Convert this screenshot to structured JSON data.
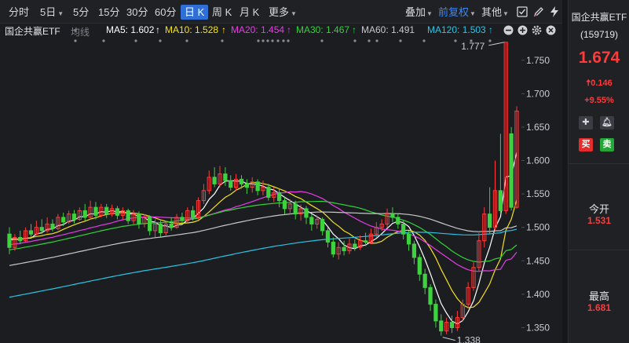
{
  "toolbar": {
    "periods": [
      {
        "label": "分时",
        "active": false
      },
      {
        "label": "5日",
        "active": false,
        "dropdown": true
      },
      {
        "label": "5分",
        "active": false
      },
      {
        "label": "15分",
        "active": false
      },
      {
        "label": "30分",
        "active": false
      },
      {
        "label": "60分",
        "active": false
      },
      {
        "label": "日 K",
        "active": true
      },
      {
        "label": "周 K",
        "active": false
      },
      {
        "label": "月 K",
        "active": false
      },
      {
        "label": "更多",
        "active": false,
        "dropdown": true
      }
    ],
    "overlay_label": "叠加",
    "adjust_label": "前复权",
    "other_label": "其他",
    "icons": [
      "checkbox-icon",
      "pencil-icon",
      "lightning-icon"
    ]
  },
  "ma_bar": {
    "indicator_label": "均线",
    "items": [
      {
        "label": "MA5: 1.602",
        "color": "#ffffff"
      },
      {
        "label": "MA10: 1.528",
        "color": "#f5e11d"
      },
      {
        "label": "MA20: 1.454",
        "color": "#e83be8"
      },
      {
        "label": "MA30: 1.467",
        "color": "#32d23a"
      },
      {
        "label": "MA60: 1.491",
        "color": "#c8c8c8"
      },
      {
        "label": "MA120: 1.503",
        "color": "#29c5e6"
      }
    ]
  },
  "chart_data": {
    "type": "candlestick",
    "y_ticks": [
      "1.750",
      "1.700",
      "1.650",
      "1.600",
      "1.550",
      "1.500",
      "1.450",
      "1.400",
      "1.350"
    ],
    "ylim": [
      1.327,
      1.785
    ],
    "high_label": "1.777",
    "low_label": "1.338",
    "up_color": "#ff3b3b",
    "down_color": "#3ed23e",
    "candles": [
      [
        1.49,
        1.47,
        1.5,
        1.46
      ],
      [
        1.47,
        1.485,
        1.49,
        1.465
      ],
      [
        1.485,
        1.48,
        1.495,
        1.475
      ],
      [
        1.48,
        1.495,
        1.5,
        1.478
      ],
      [
        1.495,
        1.49,
        1.505,
        1.485
      ],
      [
        1.49,
        1.5,
        1.51,
        1.488
      ],
      [
        1.5,
        1.495,
        1.512,
        1.49
      ],
      [
        1.495,
        1.505,
        1.515,
        1.492
      ],
      [
        1.505,
        1.498,
        1.512,
        1.494
      ],
      [
        1.498,
        1.515,
        1.52,
        1.496
      ],
      [
        1.515,
        1.508,
        1.522,
        1.502
      ],
      [
        1.508,
        1.52,
        1.525,
        1.505
      ],
      [
        1.52,
        1.512,
        1.526,
        1.506
      ],
      [
        1.512,
        1.525,
        1.53,
        1.51
      ],
      [
        1.525,
        1.515,
        1.535,
        1.51
      ],
      [
        1.515,
        1.53,
        1.54,
        1.512
      ],
      [
        1.53,
        1.518,
        1.538,
        1.512
      ],
      [
        1.518,
        1.53,
        1.535,
        1.515
      ],
      [
        1.53,
        1.52,
        1.535,
        1.514
      ],
      [
        1.52,
        1.528,
        1.534,
        1.516
      ],
      [
        1.528,
        1.518,
        1.532,
        1.512
      ],
      [
        1.518,
        1.525,
        1.53,
        1.512
      ],
      [
        1.525,
        1.51,
        1.528,
        1.505
      ],
      [
        1.51,
        1.52,
        1.526,
        1.505
      ],
      [
        1.52,
        1.505,
        1.524,
        1.498
      ],
      [
        1.505,
        1.515,
        1.52,
        1.5
      ],
      [
        1.515,
        1.495,
        1.518,
        1.488
      ],
      [
        1.495,
        1.505,
        1.512,
        1.485
      ],
      [
        1.505,
        1.492,
        1.51,
        1.486
      ],
      [
        1.492,
        1.505,
        1.51,
        1.488
      ],
      [
        1.505,
        1.5,
        1.515,
        1.495
      ],
      [
        1.5,
        1.515,
        1.52,
        1.498
      ],
      [
        1.515,
        1.51,
        1.522,
        1.505
      ],
      [
        1.51,
        1.525,
        1.53,
        1.508
      ],
      [
        1.525,
        1.515,
        1.532,
        1.51
      ],
      [
        1.515,
        1.54,
        1.545,
        1.512
      ],
      [
        1.54,
        1.555,
        1.565,
        1.535
      ],
      [
        1.555,
        1.575,
        1.585,
        1.55
      ],
      [
        1.575,
        1.565,
        1.59,
        1.56
      ],
      [
        1.565,
        1.58,
        1.592,
        1.56
      ],
      [
        1.58,
        1.57,
        1.59,
        1.562
      ],
      [
        1.57,
        1.56,
        1.578,
        1.555
      ],
      [
        1.56,
        1.572,
        1.58,
        1.555
      ],
      [
        1.572,
        1.565,
        1.578,
        1.558
      ],
      [
        1.565,
        1.56,
        1.572,
        1.55
      ],
      [
        1.56,
        1.568,
        1.575,
        1.552
      ],
      [
        1.568,
        1.555,
        1.572,
        1.548
      ],
      [
        1.555,
        1.56,
        1.57,
        1.548
      ],
      [
        1.56,
        1.545,
        1.565,
        1.54
      ],
      [
        1.545,
        1.552,
        1.56,
        1.538
      ],
      [
        1.552,
        1.54,
        1.558,
        1.53
      ],
      [
        1.54,
        1.528,
        1.545,
        1.52
      ],
      [
        1.528,
        1.535,
        1.542,
        1.52
      ],
      [
        1.535,
        1.52,
        1.54,
        1.512
      ],
      [
        1.52,
        1.528,
        1.534,
        1.51
      ],
      [
        1.528,
        1.515,
        1.532,
        1.505
      ],
      [
        1.515,
        1.505,
        1.52,
        1.495
      ],
      [
        1.505,
        1.512,
        1.518,
        1.498
      ],
      [
        1.512,
        1.495,
        1.515,
        1.488
      ],
      [
        1.495,
        1.478,
        1.5,
        1.47
      ],
      [
        1.478,
        1.46,
        1.485,
        1.455
      ],
      [
        1.46,
        1.47,
        1.478,
        1.452
      ],
      [
        1.47,
        1.465,
        1.48,
        1.458
      ],
      [
        1.465,
        1.475,
        1.485,
        1.46
      ],
      [
        1.475,
        1.47,
        1.482,
        1.465
      ],
      [
        1.47,
        1.48,
        1.488,
        1.466
      ],
      [
        1.48,
        1.478,
        1.492,
        1.472
      ],
      [
        1.478,
        1.49,
        1.498,
        1.475
      ],
      [
        1.49,
        1.5,
        1.508,
        1.485
      ],
      [
        1.5,
        1.505,
        1.512,
        1.495
      ],
      [
        1.505,
        1.52,
        1.528,
        1.5
      ],
      [
        1.52,
        1.515,
        1.53,
        1.508
      ],
      [
        1.515,
        1.505,
        1.52,
        1.498
      ],
      [
        1.505,
        1.49,
        1.51,
        1.482
      ],
      [
        1.49,
        1.475,
        1.495,
        1.465
      ],
      [
        1.475,
        1.455,
        1.48,
        1.445
      ],
      [
        1.455,
        1.43,
        1.46,
        1.42
      ],
      [
        1.43,
        1.41,
        1.438,
        1.4
      ],
      [
        1.41,
        1.385,
        1.415,
        1.375
      ],
      [
        1.385,
        1.36,
        1.392,
        1.35
      ],
      [
        1.36,
        1.345,
        1.37,
        1.338
      ],
      [
        1.345,
        1.358,
        1.365,
        1.34
      ],
      [
        1.358,
        1.35,
        1.368,
        1.342
      ],
      [
        1.35,
        1.365,
        1.375,
        1.345
      ],
      [
        1.365,
        1.385,
        1.392,
        1.36
      ],
      [
        1.385,
        1.41,
        1.418,
        1.38
      ],
      [
        1.41,
        1.44,
        1.448,
        1.405
      ],
      [
        1.44,
        1.48,
        1.492,
        1.435
      ],
      [
        1.48,
        1.52,
        1.53,
        1.47
      ],
      [
        1.52,
        1.5,
        1.56,
        1.49
      ],
      [
        1.5,
        1.555,
        1.6,
        1.495
      ],
      [
        1.555,
        1.525,
        1.64,
        1.52
      ],
      [
        1.525,
        1.777,
        1.777,
        1.52
      ],
      [
        1.64,
        1.53,
        1.65,
        1.525
      ],
      [
        1.53,
        1.674,
        1.681,
        1.528
      ]
    ],
    "ma_series": [
      {
        "name": "MA5",
        "color": "#ffffff"
      },
      {
        "name": "MA10",
        "color": "#f5e11d"
      },
      {
        "name": "MA20",
        "color": "#e83be8"
      },
      {
        "name": "MA30",
        "color": "#32d23a"
      },
      {
        "name": "MA60",
        "color": "#c8c8c8"
      },
      {
        "name": "MA120",
        "color": "#29c5e6"
      }
    ]
  },
  "quote": {
    "name": "国企共赢ETF",
    "code": "(159719)",
    "price": "1.674",
    "change": "0.146",
    "change_pct": "+9.55%",
    "buy_label": "买",
    "sell_label": "卖",
    "open_label": "今开",
    "open_value": "1.531",
    "high_label": "最高",
    "high_value": "1.681"
  },
  "header": {
    "name": "国企共赢ETF"
  }
}
